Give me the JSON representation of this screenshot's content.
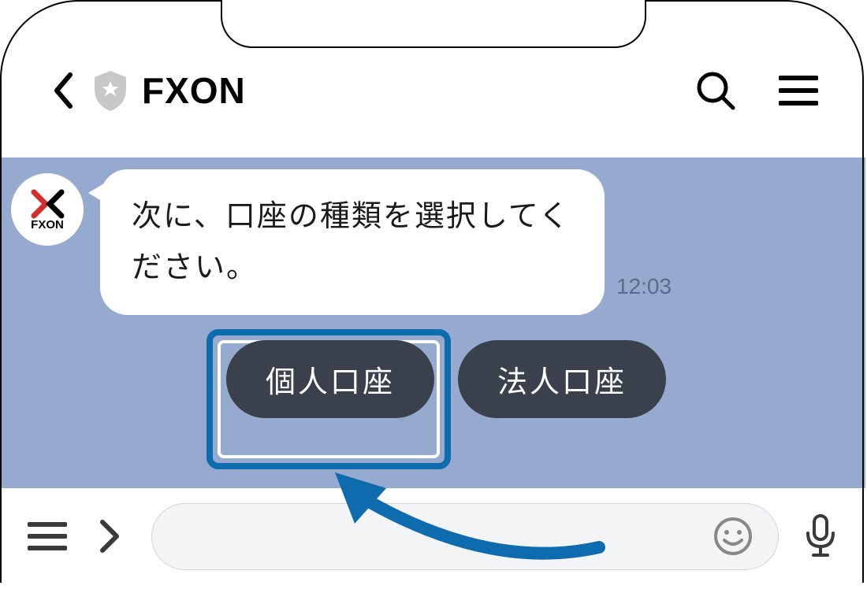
{
  "header": {
    "title": "FXON"
  },
  "chat": {
    "avatar_name": "FXON",
    "message": "次に、口座の種類を選択してください。",
    "timestamp": "12:03",
    "options": {
      "personal": "個人口座",
      "corporate": "法人口座"
    }
  }
}
